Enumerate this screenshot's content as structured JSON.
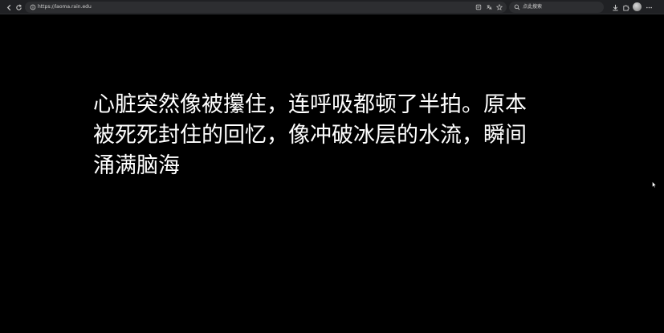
{
  "browser": {
    "url": "https://laoma.rain.edu",
    "search_text": "点此搜索",
    "icons": {
      "back": "back-arrow-icon",
      "reload": "reload-icon",
      "site_info": "site-info-icon",
      "reader": "reader-mode-icon",
      "translate": "translate-icon",
      "favorite": "star-icon",
      "search": "search-icon",
      "download": "download-icon",
      "extensions": "extensions-icon",
      "profile": "avatar",
      "menu": "more-icon"
    }
  },
  "content": {
    "lines": [
      "心脏突然像被攥住，连呼吸都顿了半拍。原本",
      "被死死封住的回忆，像冲破冰层的水流，瞬间",
      "涌满脑海"
    ]
  },
  "colors": {
    "background": "#000000",
    "text": "#ffffff",
    "toolbar": "#202124",
    "field": "#2d2e31"
  }
}
